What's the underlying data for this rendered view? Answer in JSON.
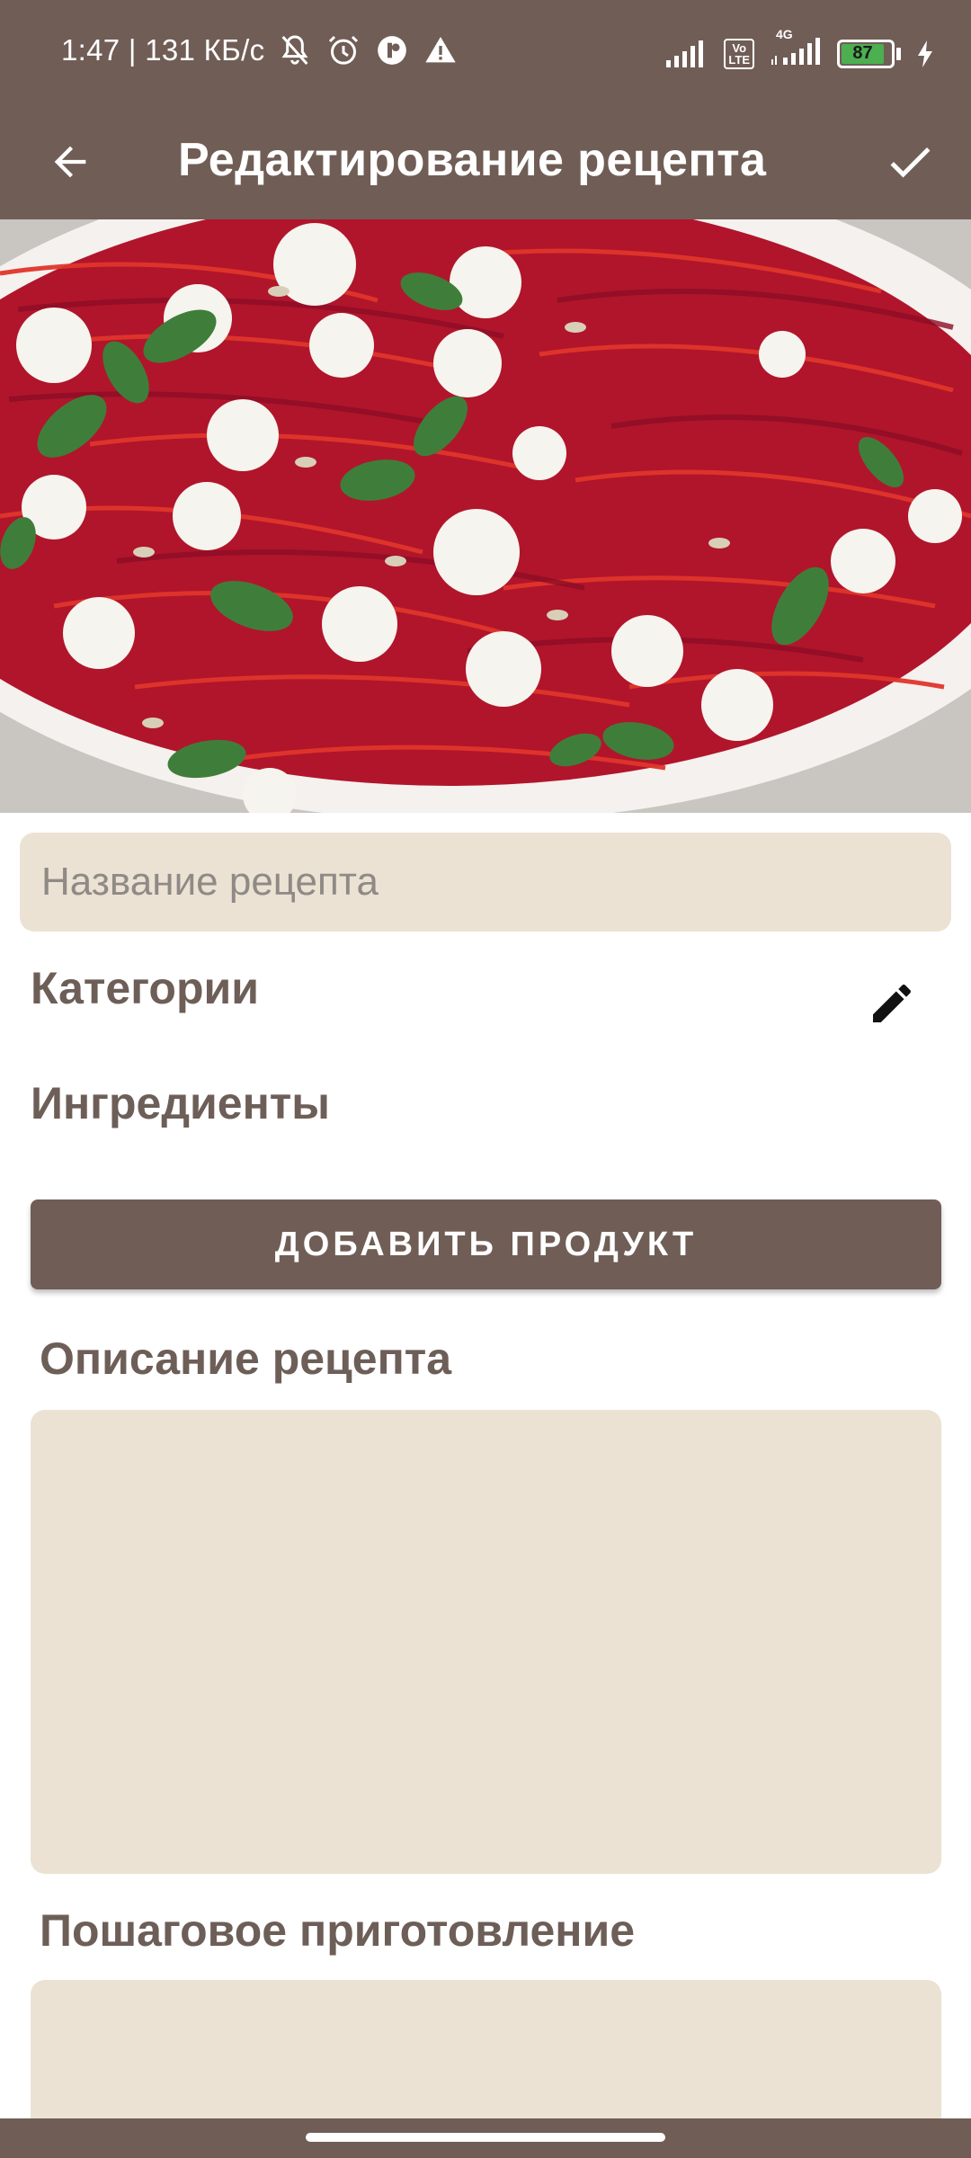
{
  "status_bar": {
    "time_speed": "1:47 | 131 КБ/с",
    "volte_label": "Vo\nLTE",
    "network_label": "4G",
    "battery_level": "87"
  },
  "app_bar": {
    "title": "Редактирование рецепта",
    "back_icon": "arrow-back-icon",
    "save_icon": "check-icon"
  },
  "hero": {
    "description_icon": "recipe-photo"
  },
  "form": {
    "name_placeholder": "Название рецепта",
    "name_value": "",
    "categories_label": "Категории",
    "ingredients_label": "Ингредиенты",
    "add_product_label": "ДОБАВИТЬ ПРОДУКТ",
    "description_label": "Описание рецепта",
    "description_value": "",
    "steps_label": "Пошаговое приготовление",
    "steps_value": ""
  },
  "colors": {
    "primary": "#705d56",
    "field_bg": "#ebe2d3",
    "section_text": "#6d5e58",
    "battery": "#4caf50"
  }
}
